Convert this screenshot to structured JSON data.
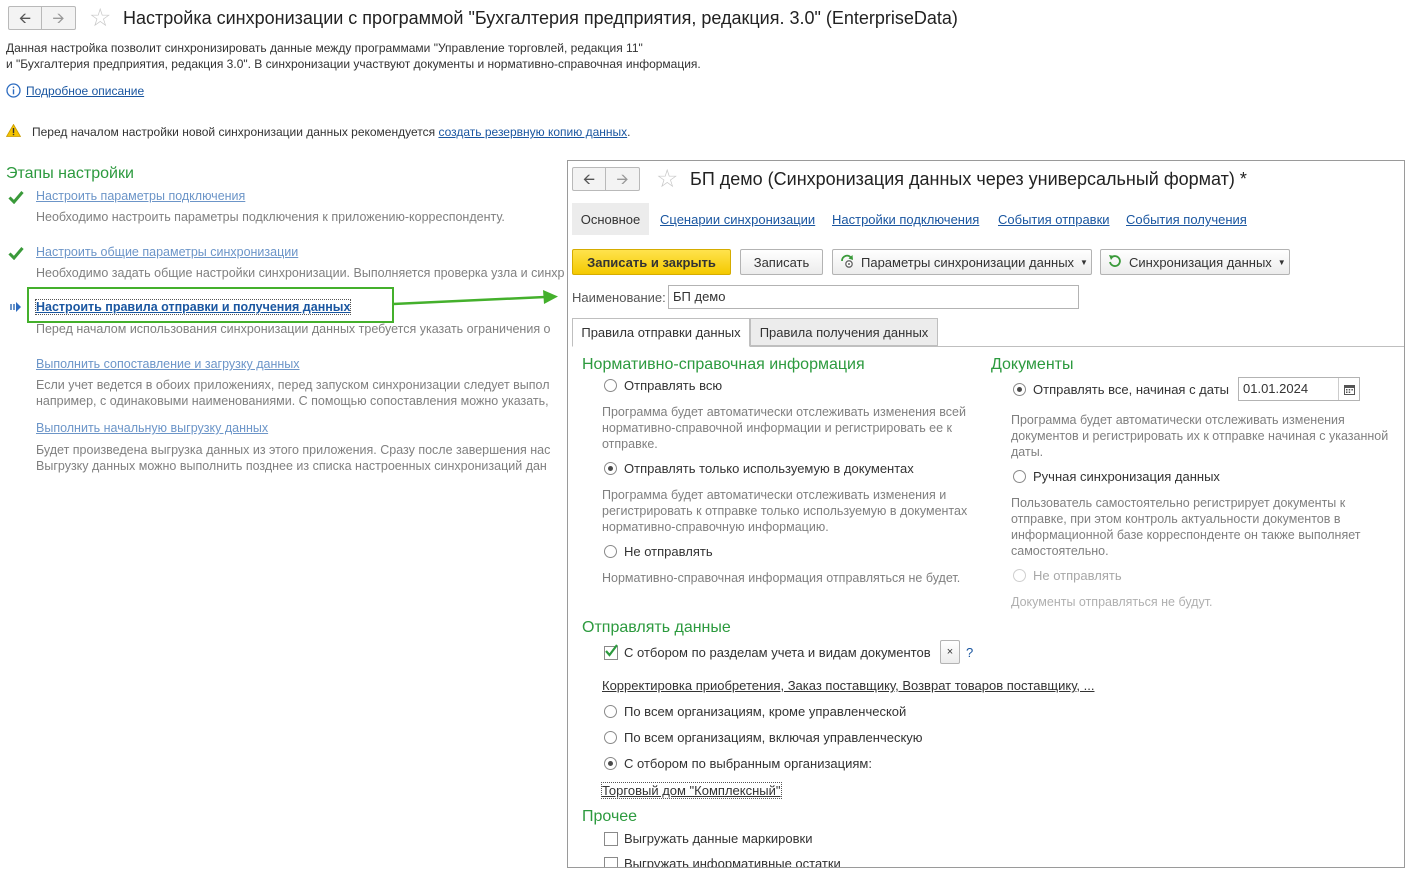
{
  "main": {
    "title": "Настройка синхронизации с программой \"Бухгалтерия предприятия, редакция. 3.0\" (EnterpriseData)",
    "intro_line1": "Данная настройка позволит синхронизировать данные между программами \"Управление торговлей, редакция 11\"",
    "intro_line2": "и \"Бухгалтерия предприятия, редакция 3.0\".  В синхронизации участвуют документы и нормативно-справочная информация.",
    "details_link": "Подробное описание",
    "warning_text": "Перед началом настройки новой синхронизации данных рекомендуется ",
    "warning_link": "создать резервную копию данных",
    "warning_end": ".",
    "stages_heading": "Этапы настройки",
    "steps": [
      {
        "label": "Настроить параметры подключения",
        "desc": "Необходимо настроить параметры подключения к приложению-корреспонденту."
      },
      {
        "label": "Настроить общие параметры синхронизации",
        "desc": "Необходимо задать общие настройки синхронизации. Выполняется проверка узла и синхр"
      },
      {
        "label": "Настроить правила отправки и получения данных",
        "desc": "Перед началом использования синхронизации данных требуется указать ограничения о"
      },
      {
        "label": "Выполнить сопоставление и загрузку данных",
        "desc1": "Если учет ведется в обоих приложениях, перед запуском синхронизации следует выпол",
        "desc2": "например, с одинаковыми наименованиями. С помощью сопоставления можно указать,"
      },
      {
        "label": "Выполнить начальную выгрузку данных",
        "desc1": "Будет произведена выгрузка данных из этого приложения. Сразу после завершения нас",
        "desc2": "Выгрузку данных можно выполнить позднее из списка настроенных синхронизаций дан"
      }
    ]
  },
  "dialog": {
    "title": "БП демо (Синхронизация данных через универсальный формат) *",
    "nav": [
      "Основное",
      "Сценарии синхронизации",
      "Настройки подключения",
      "События отправки",
      "События получения"
    ],
    "toolbar": {
      "save_close": "Записать и закрыть",
      "save": "Записать",
      "params": "Параметры синхронизации данных",
      "sync": "Синхронизация данных"
    },
    "name_label": "Наименование:",
    "name_value": "БП демо",
    "tabs": [
      "Правила отправки данных",
      "Правила получения данных"
    ],
    "nsi": {
      "heading": "Нормативно-справочная информация",
      "opt1": "Отправлять всю",
      "opt1_desc": [
        "Программа будет автоматически отслеживать изменения всей",
        "нормативно-справочной информации и регистрировать ее к",
        "отправке."
      ],
      "opt2": "Отправлять только используемую в документах",
      "opt2_desc": [
        "Программа будет автоматически отслеживать изменения и",
        "регистрировать к отправке только используемую в документах",
        "нормативно-справочную информацию."
      ],
      "opt3": "Не отправлять",
      "opt3_desc": "Нормативно-справочная информация отправляться не будет."
    },
    "docs": {
      "heading": "Документы",
      "opt1": "Отправлять все, начиная с даты",
      "date": "01.01.2024",
      "opt1_desc": [
        "Программа будет автоматически отслеживать изменения",
        "документов и регистрировать их к отправке начиная с указанной",
        "даты."
      ],
      "opt2": "Ручная синхронизация данных",
      "opt2_desc": [
        "Пользователь самостоятельно регистрирует документы к",
        "отправке, при этом контроль актуальности документов в",
        "информационной базе корреспонденте он также выполняет",
        "самостоятельно."
      ],
      "opt3": "Не отправлять",
      "opt3_desc": "Документы отправляться не будут."
    },
    "send": {
      "heading": "Отправлять данные",
      "filter_label": "С отбором по разделам учета и видам документов",
      "clear": "×",
      "help": "?",
      "filter_link": "Корректировка приобретения, Заказ поставщику, Возврат товаров поставщику, ...",
      "org1": "По всем организациям, кроме управленческой",
      "org2": "По всем организациям, включая управленческую",
      "org3": "С отбором по выбранным организациям:",
      "org_link": "Торговый дом \"Комплексный\""
    },
    "other": {
      "heading": "Прочее",
      "chk1": "Выгружать данные маркировки",
      "chk2": "Выгружать информативные остатки"
    }
  },
  "colors": {
    "accent_green": "#2c9a3e",
    "link_blue": "#1a56a0",
    "highlight": "#44b02c",
    "yellow_button": "#f4c900"
  }
}
